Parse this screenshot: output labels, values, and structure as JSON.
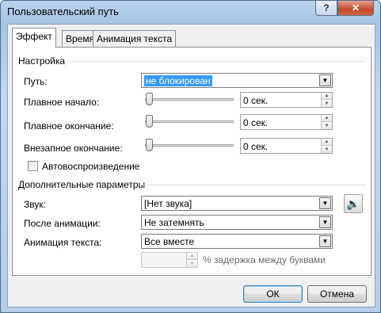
{
  "window": {
    "title": "Пользовательский путь",
    "help_label": "?",
    "close_label": "✕"
  },
  "tabs": [
    {
      "label": "Эффект",
      "active": true
    },
    {
      "label": "Время",
      "active": false
    },
    {
      "label": "Анимация текста",
      "active": false
    }
  ],
  "settings": {
    "section_title": "Настройка",
    "path_label": "Путь:",
    "path_value": "не блокирован",
    "smooth_start_label": "Плавное начало:",
    "smooth_start_value": "0 сек.",
    "smooth_end_label": "Плавное окончание:",
    "smooth_end_value": "0 сек.",
    "sudden_end_label": "Внезапное окончание:",
    "sudden_end_value": "0 сек.",
    "autoreverse_label": "Автовоспроизведение",
    "autoreverse_checked": false
  },
  "extra": {
    "section_title": "Дополнительные параметры",
    "sound_label": "Звук:",
    "sound_value": "[Нет звука]",
    "after_label": "После анимации:",
    "after_value": "Не затемнять",
    "text_anim_label": "Анимация текста:",
    "text_anim_value": "Все вместе",
    "delay_label": "% задержка между буквами",
    "delay_value": ""
  },
  "icons": {
    "dropdown": "▼",
    "spin_up": "▲",
    "spin_down": "▼",
    "speaker": "🔈"
  },
  "buttons": {
    "ok": "ОК",
    "cancel": "Отмена"
  }
}
